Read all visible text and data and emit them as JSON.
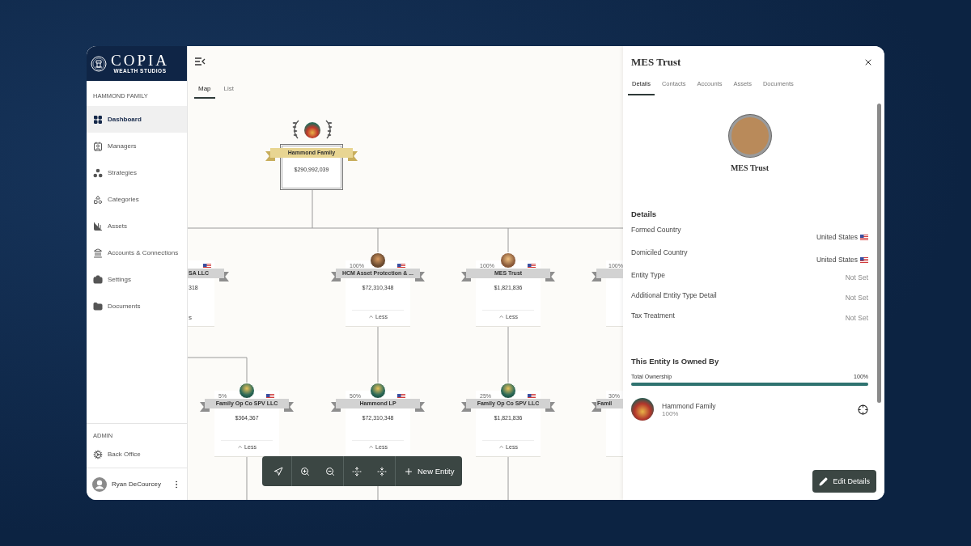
{
  "sidebar": {
    "logo": {
      "title": "COPIA",
      "subtitle": "WEALTH STUDIOS"
    },
    "section": "HAMMOND FAMILY",
    "items": [
      {
        "label": "Dashboard",
        "selected": true
      },
      {
        "label": "Managers",
        "selected": false
      },
      {
        "label": "Strategies",
        "selected": false
      },
      {
        "label": "Categories",
        "selected": false
      },
      {
        "label": "Assets",
        "selected": false
      },
      {
        "label": "Accounts & Connections",
        "selected": false
      },
      {
        "label": "Settings",
        "selected": false
      },
      {
        "label": "Documents",
        "selected": false
      }
    ],
    "admin_section": "ADMIN",
    "admin_items": [
      {
        "label": "Back Office",
        "selected": false
      }
    ],
    "user": {
      "name": "Ryan DeCourcey"
    }
  },
  "map": {
    "tabs": [
      {
        "label": "Map",
        "selected": true
      },
      {
        "label": "List",
        "selected": false
      }
    ],
    "root": {
      "name": "Hammond Family",
      "value": "$290,992,039"
    },
    "tiers": [
      {
        "nodes": [
          {
            "kind": "clipped_left",
            "name": "SA LLC",
            "value": "318",
            "toggle": "s"
          },
          {
            "kind": "full",
            "percent": "100%",
            "name": "HCM Asset Protection & ...",
            "value": "$72,310,348",
            "toggle": "Less"
          },
          {
            "kind": "full",
            "percent": "100%",
            "name": "MES Trust",
            "value": "$1,821,836",
            "toggle": "Less"
          },
          {
            "kind": "clipped_right",
            "percent": "100%"
          }
        ]
      },
      {
        "nodes": [
          {
            "kind": "full",
            "percent": "5%",
            "name": "Family Op Co SPV LLC",
            "value": "$364,367",
            "toggle": "Less"
          },
          {
            "kind": "full",
            "percent": "50%",
            "name": "Hammond LP",
            "value": "$72,310,348",
            "toggle": "Less"
          },
          {
            "kind": "full",
            "percent": "25%",
            "name": "Family Op Co SPV LLC",
            "value": "$1,821,836",
            "toggle": "Less"
          },
          {
            "kind": "clipped_right",
            "percent": "30%",
            "name": "Famil"
          }
        ]
      }
    ],
    "toolbar": {
      "tools": [
        {
          "kind": "locate"
        },
        {
          "kind": "zoom_in"
        },
        {
          "kind": "zoom_out"
        },
        {
          "kind": "expand"
        },
        {
          "kind": "collapse"
        }
      ],
      "new_button": "New Entity"
    }
  },
  "panel": {
    "title": "MES Trust",
    "tabs": [
      {
        "label": "Details",
        "selected": true
      },
      {
        "label": "Contacts",
        "selected": false
      },
      {
        "label": "Accounts",
        "selected": false
      },
      {
        "label": "Assets",
        "selected": false
      },
      {
        "label": "Documents",
        "selected": false
      }
    ],
    "entity_name": "MES Trust",
    "details_heading": "Details",
    "details": [
      {
        "label": "Formed Country",
        "value": "United States",
        "flag": true
      },
      {
        "label": "Domiciled Country",
        "value": "United States",
        "flag": true
      },
      {
        "label": "Entity Type",
        "value": "Not Set",
        "flag": false
      },
      {
        "label": "Additional Entity Type Detail",
        "value": "Not Set",
        "flag": false
      },
      {
        "label": "Tax Treatment",
        "value": "Not Set",
        "flag": false
      }
    ],
    "owned_heading": "This Entity Is Owned By",
    "ownership": {
      "label": "Total Ownership",
      "reading": "100%",
      "level": 1
    },
    "owners": [
      {
        "name": "Hammond Family",
        "share": "100%"
      }
    ],
    "edit_button": "Edit Details"
  }
}
